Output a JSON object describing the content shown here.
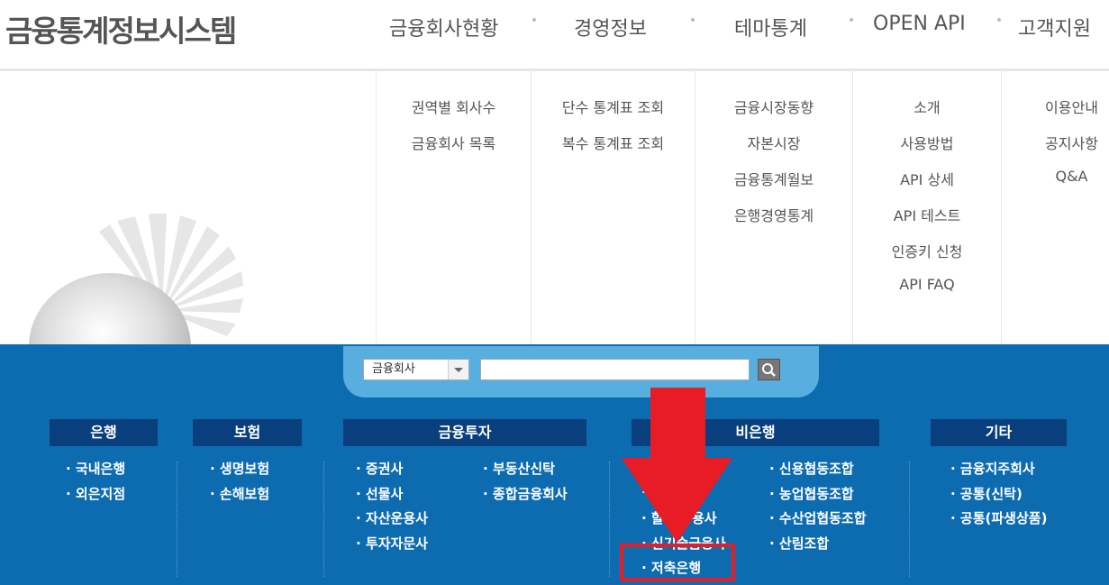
{
  "header": {
    "logo": "금융통계정보시스템",
    "nav": [
      "금융회사현황",
      "경영정보",
      "테마통계",
      "OPEN API",
      "고객지원"
    ]
  },
  "dropdown": {
    "col1": [
      "권역별 회사수",
      "금융회사 목록"
    ],
    "col2": [
      "단수 통계표 조회",
      "복수 통계표 조회"
    ],
    "col3": [
      "금융시장동향",
      "자본시장",
      "금융통계월보",
      "은행경영통계"
    ],
    "col4": [
      "소개",
      "사용방법",
      "API 상세",
      "API 테스트",
      "인증키 신청",
      "API FAQ"
    ],
    "col5": [
      "이용안내",
      "공지사항",
      "Q&A"
    ]
  },
  "search": {
    "select_value": "금융회사",
    "input_value": "",
    "button_icon": "search-icon"
  },
  "categories": {
    "bank": {
      "title": "은행",
      "links": [
        "· 국내은행",
        "· 외은지점"
      ]
    },
    "insurance": {
      "title": "보험",
      "links": [
        "· 생명보험",
        "· 손해보험"
      ]
    },
    "investment": {
      "title": "금융투자",
      "links_left": [
        "· 증권사",
        "· 선물사",
        "· 자산운용사",
        "· 투자자문사"
      ],
      "links_right": [
        "· 부동산신탁",
        "· 종합금융회사"
      ]
    },
    "nonbank": {
      "title": "비은행",
      "links_left_partial": [
        "· 할",
        "용사",
        "· 신기술금융사",
        "· 저축은행"
      ],
      "links_right": [
        "· 신용협동조합",
        "· 농업협동조합",
        "· 수산업협동조합",
        "· 산림조합"
      ]
    },
    "other": {
      "title": "기타",
      "links": [
        "· 금융지주회사",
        "· 공통(신탁)",
        "· 공통(파생상품)"
      ]
    }
  },
  "annotation": {
    "arrow_color": "#e81c24",
    "box_color": "#e81c24"
  }
}
